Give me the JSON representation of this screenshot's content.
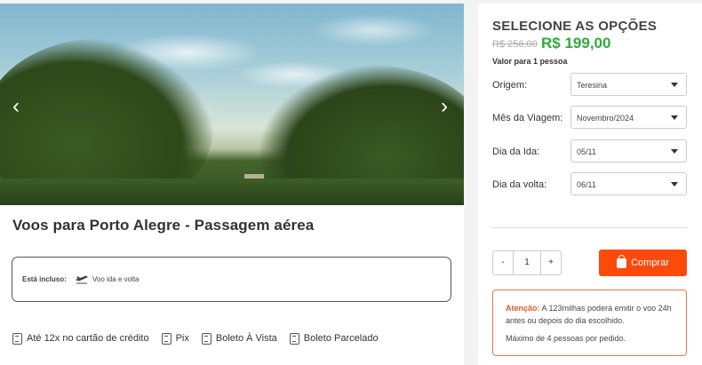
{
  "hero": {
    "prev_icon": "chevron-left-icon",
    "next_icon": "chevron-right-icon"
  },
  "product": {
    "title": "Voos para Porto Alegre - Passagem aérea",
    "included_label": "Está incluso:",
    "included_item": "Voo ida e volta"
  },
  "payments": [
    {
      "label": "Até 12x no cartão de crédito"
    },
    {
      "label": "Pix"
    },
    {
      "label": "Boleto À Vista"
    },
    {
      "label": "Boleto Parcelado"
    }
  ],
  "panel": {
    "title": "SELECIONE AS OPÇÕES",
    "old_price": "R$ 256,00",
    "price": "R$ 199,00",
    "per_person": "Valor para 1 pessoa",
    "fields": [
      {
        "label": "Origem:",
        "value": "Teresina"
      },
      {
        "label": "Mês da Viagem:",
        "value": "Novembro/2024"
      },
      {
        "label": "Dia da Ida:",
        "value": "05/11"
      },
      {
        "label": "Dia da volta:",
        "value": "06/11"
      }
    ],
    "quantity": {
      "minus": "-",
      "value": "1",
      "plus": "+"
    },
    "buy_label": "Comprar",
    "note": {
      "attention": "Atenção:",
      "text": " A 123milhas poderá emitir o voo 24h antes ou depois do dia escolhido.",
      "max": "Máximo de 4 pessoas por pedido."
    }
  },
  "colors": {
    "price": "#2eab3b",
    "buy": "#fb4a0a",
    "attention": "#e8581a"
  }
}
